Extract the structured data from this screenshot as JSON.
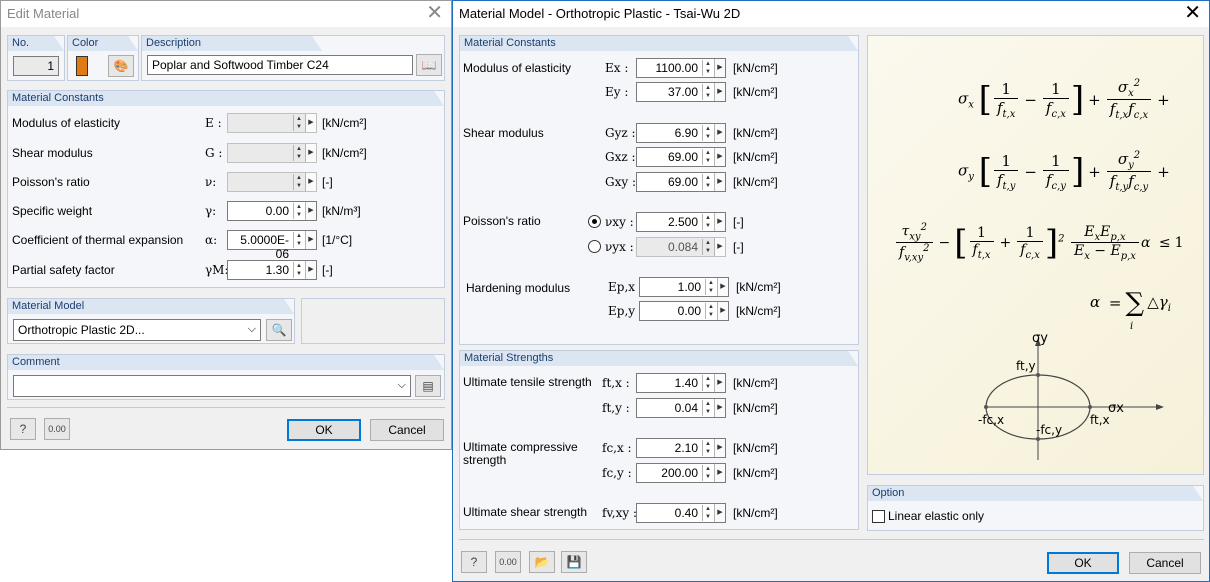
{
  "edit_material": {
    "title": "Edit Material",
    "no_label": "No.",
    "no_value": "1",
    "color_label": "Color",
    "color_value": "#e07b14",
    "description_label": "Description",
    "description_value": "Poplar and Softwood Timber C24",
    "constants_header": "Material Constants",
    "rows": [
      {
        "label": "Modulus of elasticity",
        "symbol": "E :",
        "value": "",
        "unit": "[kN/cm²]",
        "enabled": false
      },
      {
        "label": "Shear modulus",
        "symbol": "G :",
        "value": "",
        "unit": "[kN/cm²]",
        "enabled": false
      },
      {
        "label": "Poisson's ratio",
        "symbol": "ν:",
        "value": "",
        "unit": "[-]",
        "enabled": false
      },
      {
        "label": "Specific weight",
        "symbol": "γ:",
        "value": "0.00",
        "unit": "[kN/m³]",
        "enabled": true
      },
      {
        "label": "Coefficient of thermal expansion",
        "symbol": "α:",
        "value": "5.0000E-06",
        "unit": "[1/°C]",
        "enabled": true
      },
      {
        "label": "Partial safety factor",
        "symbol": "γM:",
        "value": "1.30",
        "unit": "[-]",
        "enabled": true
      }
    ],
    "model_header": "Material Model",
    "model_value": "Orthotropic Plastic 2D...",
    "comment_header": "Comment",
    "comment_value": "",
    "ok": "OK",
    "cancel": "Cancel",
    "zero_icon_text": "0.00"
  },
  "material_model": {
    "title": "Material Model - Orthotropic Plastic - Tsai-Wu 2D",
    "constants_header": "Material Constants",
    "modulus_label": "Modulus of elasticity",
    "modulus_rows": [
      {
        "symbol": "Ex :",
        "value": "1100.00",
        "unit": "[kN/cm²]"
      },
      {
        "symbol": "Ey :",
        "value": "37.00",
        "unit": "[kN/cm²]"
      }
    ],
    "shear_label": "Shear modulus",
    "shear_rows": [
      {
        "symbol": "Gyz :",
        "value": "6.90",
        "unit": "[kN/cm²]"
      },
      {
        "symbol": "Gxz :",
        "value": "69.00",
        "unit": "[kN/cm²]"
      },
      {
        "symbol": "Gxy :",
        "value": "69.00",
        "unit": "[kN/cm²]"
      }
    ],
    "poisson_label": "Poisson's ratio",
    "poisson_rows": [
      {
        "symbol": "νxy :",
        "value": "2.500",
        "unit": "[-]",
        "selected": true
      },
      {
        "symbol": "νyx :",
        "value": "0.084",
        "unit": "[-]",
        "selected": false
      }
    ],
    "hardening_label": "Hardening modulus",
    "hardening_rows": [
      {
        "symbol": "Ep,x :",
        "value": "1.00",
        "unit": "[kN/cm²]"
      },
      {
        "symbol": "Ep,y :",
        "value": "0.00",
        "unit": "[kN/cm²]"
      }
    ],
    "strengths_header": "Material Strengths",
    "tensile_label": "Ultimate tensile strength",
    "tensile_rows": [
      {
        "symbol": "ft,x :",
        "value": "1.40",
        "unit": "[kN/cm²]"
      },
      {
        "symbol": "ft,y :",
        "value": "0.04",
        "unit": "[kN/cm²]"
      }
    ],
    "compressive_label_1": "Ultimate compressive",
    "compressive_label_2": "strength",
    "compressive_rows": [
      {
        "symbol": "fc,x :",
        "value": "2.10",
        "unit": "[kN/cm²]"
      },
      {
        "symbol": "fc,y :",
        "value": "200.00",
        "unit": "[kN/cm²]"
      }
    ],
    "shear_strength_label": "Ultimate shear strength",
    "shear_strength_row": {
      "symbol": "fv,xy :",
      "value": "0.40",
      "unit": "[kN/cm²]"
    },
    "option_header": "Option",
    "linear_elastic_label": "Linear elastic only",
    "linear_elastic_checked": false,
    "ok": "OK",
    "cancel": "Cancel",
    "zero_icon_text": "0.00",
    "diagram": {
      "sigma_y": "σy",
      "sigma_x": "σx",
      "ft_y": "ft,y",
      "ft_x": "ft,x",
      "fc_x": "-fc,x",
      "fc_y": "-fc,y"
    }
  }
}
